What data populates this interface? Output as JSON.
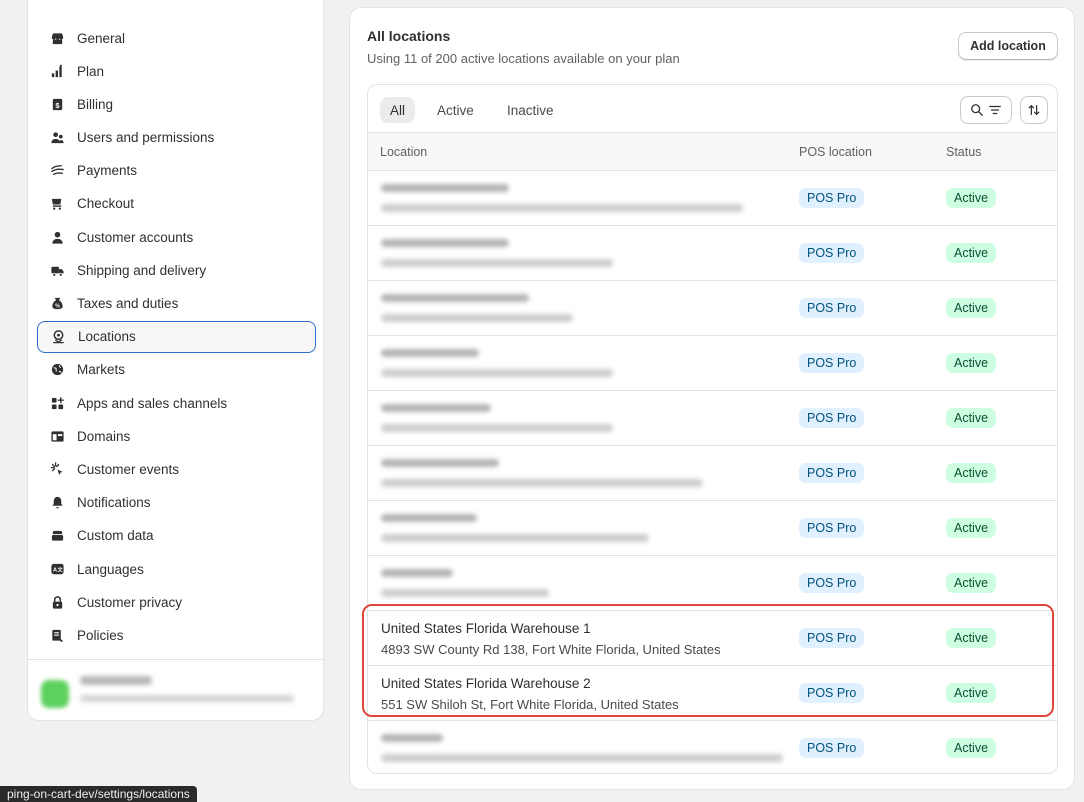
{
  "sidebar": {
    "items": [
      {
        "label": "General",
        "icon": "store-icon",
        "active": false
      },
      {
        "label": "Plan",
        "icon": "plan-icon",
        "active": false
      },
      {
        "label": "Billing",
        "icon": "billing-icon",
        "active": false
      },
      {
        "label": "Users and permissions",
        "icon": "users-icon",
        "active": false
      },
      {
        "label": "Payments",
        "icon": "payments-icon",
        "active": false
      },
      {
        "label": "Checkout",
        "icon": "cart-icon",
        "active": false
      },
      {
        "label": "Customer accounts",
        "icon": "person-icon",
        "active": false
      },
      {
        "label": "Shipping and delivery",
        "icon": "truck-icon",
        "active": false
      },
      {
        "label": "Taxes and duties",
        "icon": "tax-icon",
        "active": false
      },
      {
        "label": "Locations",
        "icon": "location-icon",
        "active": true
      },
      {
        "label": "Markets",
        "icon": "globe-icon",
        "active": false
      },
      {
        "label": "Apps and sales channels",
        "icon": "apps-icon",
        "active": false
      },
      {
        "label": "Domains",
        "icon": "domain-icon",
        "active": false
      },
      {
        "label": "Customer events",
        "icon": "cursor-click-icon",
        "active": false
      },
      {
        "label": "Notifications",
        "icon": "bell-icon",
        "active": false
      },
      {
        "label": "Custom data",
        "icon": "database-icon",
        "active": false
      },
      {
        "label": "Languages",
        "icon": "language-icon",
        "active": false
      },
      {
        "label": "Customer privacy",
        "icon": "lock-icon",
        "active": false
      },
      {
        "label": "Policies",
        "icon": "policy-icon",
        "active": false
      }
    ]
  },
  "main": {
    "title": "All locations",
    "subtitle": "Using 11 of 200 active locations available on your plan",
    "add_button": "Add location",
    "tabs": [
      {
        "label": "All",
        "active": true
      },
      {
        "label": "Active",
        "active": false
      },
      {
        "label": "Inactive",
        "active": false
      }
    ],
    "columns": {
      "location": "Location",
      "pos": "POS location",
      "status": "Status"
    },
    "rows": [
      {
        "blurred": true,
        "name": "",
        "address": "",
        "pos": "POS Pro",
        "status": "Active"
      },
      {
        "blurred": true,
        "name": "",
        "address": "",
        "pos": "POS Pro",
        "status": "Active"
      },
      {
        "blurred": true,
        "name": "",
        "address": "",
        "pos": "POS Pro",
        "status": "Active"
      },
      {
        "blurred": true,
        "name": "",
        "address": "",
        "pos": "POS Pro",
        "status": "Active"
      },
      {
        "blurred": true,
        "name": "",
        "address": "",
        "pos": "POS Pro",
        "status": "Active"
      },
      {
        "blurred": true,
        "name": "",
        "address": "",
        "pos": "POS Pro",
        "status": "Active"
      },
      {
        "blurred": true,
        "name": "",
        "address": "",
        "pos": "POS Pro",
        "status": "Active"
      },
      {
        "blurred": true,
        "name": "",
        "address": "",
        "pos": "POS Pro",
        "status": "Active"
      },
      {
        "blurred": false,
        "name": "United States Florida Warehouse 1",
        "address": "4893 SW County Rd 138, Fort White Florida, United States",
        "pos": "POS Pro",
        "status": "Active"
      },
      {
        "blurred": false,
        "name": "United States Florida Warehouse 2",
        "address": "551 SW Shiloh St, Fort White Florida, United States",
        "pos": "POS Pro",
        "status": "Active"
      },
      {
        "blurred": true,
        "name": "",
        "address": "",
        "pos": "POS Pro",
        "status": "Active"
      }
    ]
  },
  "status_url": "ping-on-cart-dev/settings/locations",
  "colors": {
    "active_outline": "#2c6ecb",
    "highlight": "#e0463c",
    "pos_badge_bg": "#e0f0ff",
    "status_badge_bg": "#cdfee1"
  }
}
